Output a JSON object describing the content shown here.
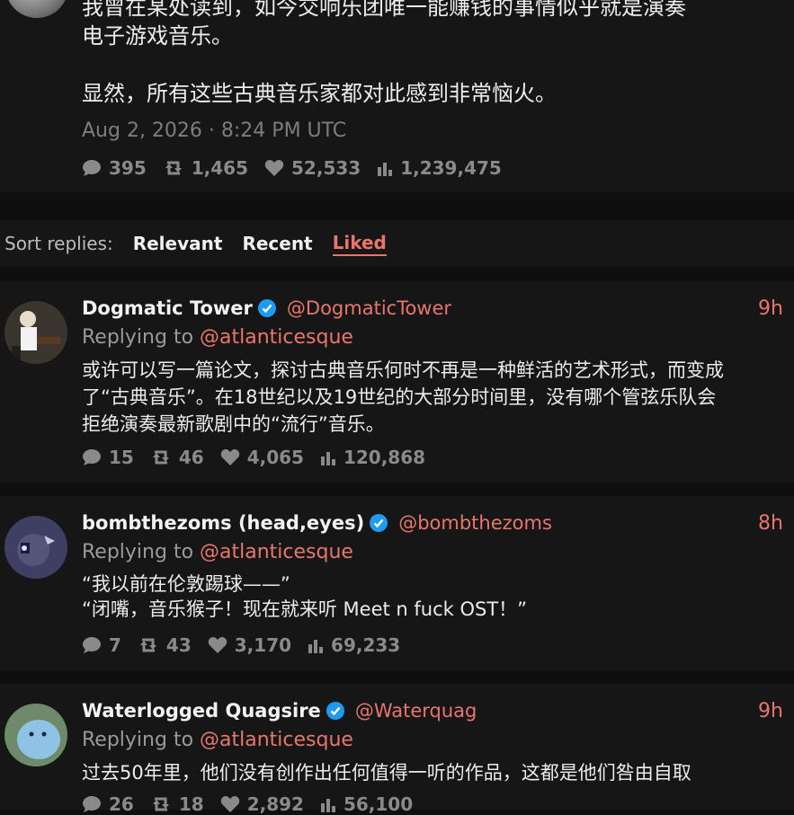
{
  "main_tweet": {
    "text": "我曾在某处读到，如今交响乐团唯一能赚钱的事情似乎就是演奏\n电子游戏音乐。\n\n显然，所有这些古典音乐家都对此感到非常恼火。",
    "date": "Aug 2, 2026 · 8:24 PM UTC",
    "stats": {
      "replies": "395",
      "retweets": "1,465",
      "likes": "52,533",
      "views": "1,239,475"
    }
  },
  "sort": {
    "label": "Sort replies:",
    "options": [
      "Relevant",
      "Recent",
      "Liked"
    ],
    "active": "Liked"
  },
  "replies": [
    {
      "name": "Dogmatic Tower",
      "handle": "@DogmaticTower",
      "time": "9h",
      "replying_prefix": "Replying to ",
      "replying_to": "@atlanticesque",
      "text": "或许可以写一篇论文，探讨古典音乐何时不再是一种鲜活的艺术形式，而变成\n了“古典音乐”。在18世纪以及19世纪的大部分时间里，没有哪个管弦乐队会\n拒绝演奏最新歌剧中的“流行”音乐。",
      "stats": {
        "replies": "15",
        "retweets": "46",
        "likes": "4,065",
        "views": "120,868"
      }
    },
    {
      "name": "bombthezoms (head,eyes)",
      "handle": "@bombthezoms",
      "time": "8h",
      "replying_prefix": "Replying to ",
      "replying_to": "@atlanticesque",
      "text": "“我以前在伦敦踢球——”\n“闭嘴，音乐猴子！现在就来听 Meet n fuck OST！”",
      "stats": {
        "replies": "7",
        "retweets": "43",
        "likes": "3,170",
        "views": "69,233"
      }
    },
    {
      "name": "Waterlogged Quagsire",
      "handle": "@Waterquag",
      "time": "9h",
      "replying_prefix": "Replying to ",
      "replying_to": "@atlanticesque",
      "text": "过去50年里，他们没有创作出任何值得一听的作品，这都是他们咎由自取",
      "stats": {
        "replies": "26",
        "retweets": "18",
        "likes": "2,892",
        "views": "56,100"
      }
    }
  ],
  "colors": {
    "accent": "#e8766c",
    "verified": "#1d9bf0",
    "panel": "#161616",
    "background": "#0f0f0f"
  }
}
